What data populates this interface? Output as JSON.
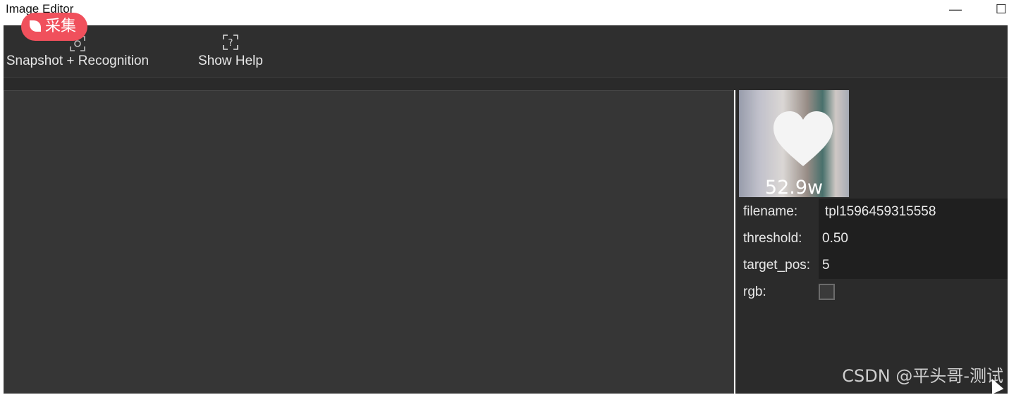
{
  "window": {
    "title": "Image Editor",
    "minimize": "—",
    "maximize": "☐"
  },
  "toolbar": {
    "snapshot_label": "Snapshot + Recognition",
    "help_label": "Show Help"
  },
  "overlay_badge": "采集",
  "thumbnail": {
    "count_label": "52.9w"
  },
  "properties": {
    "filename_key": "filename:",
    "filename_value": "tpl1596459315558",
    "threshold_key": "threshold:",
    "threshold_value": "0.50",
    "target_pos_key": "target_pos:",
    "target_pos_value": "5",
    "rgb_key": "rgb:",
    "rgb_checked": false
  },
  "watermark": "CSDN @平头哥-测试"
}
